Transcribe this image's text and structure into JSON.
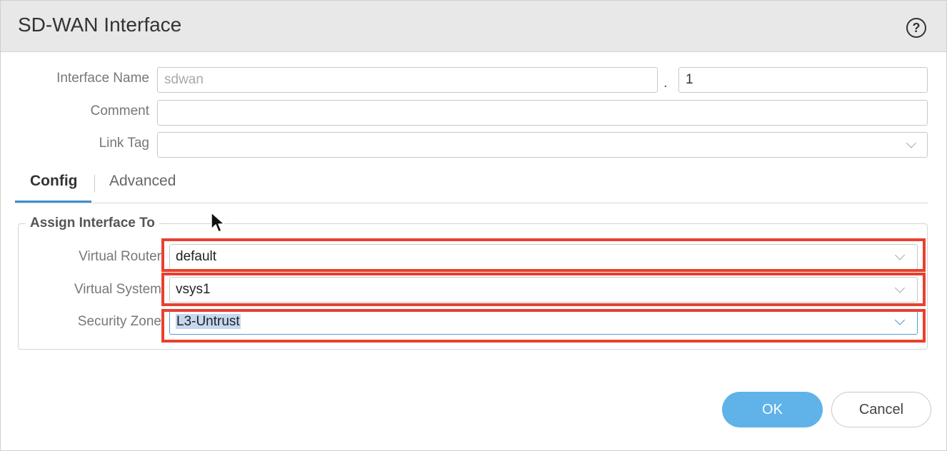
{
  "dialog": {
    "title": "SD-WAN Interface",
    "help_icon": "question-circle-icon",
    "help_glyph": "?"
  },
  "fields": {
    "interface_name": {
      "label": "Interface Name",
      "value": "sdwan",
      "separator": ".",
      "suffix": "1"
    },
    "comment": {
      "label": "Comment",
      "value": ""
    },
    "link_tag": {
      "label": "Link Tag",
      "value": "",
      "icon": "chevron-down-icon"
    }
  },
  "tabs": [
    {
      "label": "Config",
      "active": true
    },
    {
      "label": "Advanced",
      "active": false
    }
  ],
  "assign": {
    "legend": "Assign Interface To",
    "virtual_router": {
      "label": "Virtual Router",
      "value": "default"
    },
    "virtual_system": {
      "label": "Virtual System",
      "value": "vsys1"
    },
    "security_zone": {
      "label": "Security Zone",
      "value": "L3-Untrust"
    }
  },
  "buttons": {
    "ok": "OK",
    "cancel": "Cancel"
  },
  "colors": {
    "accent": "#3e8ed0",
    "ok_button": "#5fb3e8",
    "highlight": "#e8402f"
  }
}
